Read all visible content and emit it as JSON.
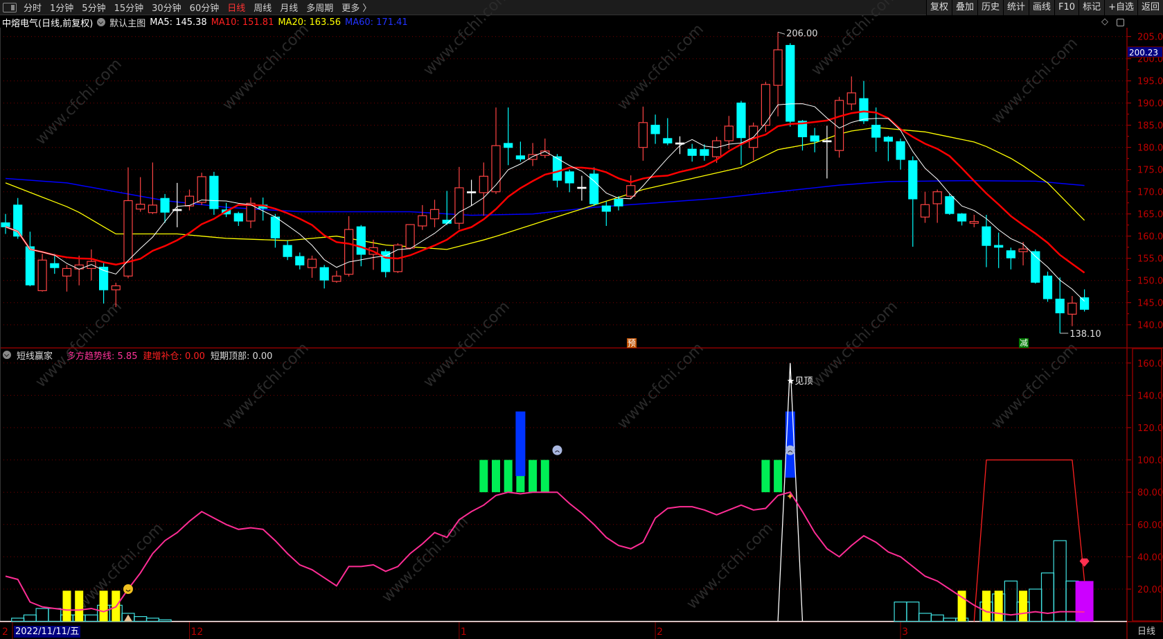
{
  "toolbar": {
    "periods": [
      "分时",
      "1分钟",
      "5分钟",
      "15分钟",
      "30分钟",
      "60分钟",
      "日线",
      "周线",
      "月线",
      "多周期",
      "更多 〉"
    ],
    "active": "日线",
    "right_buttons": [
      "复权",
      "叠加",
      "历史",
      "统计",
      "画线",
      "F10",
      "标记",
      "+自选",
      "返回"
    ]
  },
  "info": {
    "stock": "中熔电气(日线,前复权)",
    "template": "默认主图",
    "ma5": "MA5: 145.38",
    "ma10": "MA10: 151.81",
    "ma20": "MA20: 163.56",
    "ma60": "MA60: 171.41"
  },
  "colors": {
    "up": "#ff4444",
    "down": "#00ffff",
    "ma5": "#ffffff",
    "ma10": "#ff0000",
    "ma20": "#ffff00",
    "ma60": "#0000ff",
    "grid": "#7a0000",
    "axis": "#c00000"
  },
  "indicator": {
    "name": "短线赢家",
    "trend": "多方趋势线: 5.85",
    "add": "建增补仓: 0.00",
    "top": "短期顶部: 0.00",
    "top_label": "★见顶"
  },
  "cursor": {
    "date": "2022/11/11/五",
    "price": "200.23"
  },
  "period_label": "日线",
  "markers": {
    "pre": "预",
    "reduce": "减"
  },
  "watermark": "www.cfchi.com",
  "chart_data": {
    "type": "candlestick",
    "price_axis": {
      "min": 137,
      "max": 207,
      "ticks": [
        "205.0",
        "200.0",
        "195.0",
        "190.0",
        "185.0",
        "180.0",
        "175.0",
        "170.0",
        "165.0",
        "160.0",
        "155.0",
        "150.0",
        "145.0",
        "140.0"
      ]
    },
    "ind_axis": {
      "ticks": [
        "160.0",
        "140.0",
        "120.0",
        "100.0",
        "80.00",
        "60.00",
        "40.00",
        "20.00"
      ]
    },
    "date_ticks": [
      {
        "i": 0,
        "label": "2"
      },
      {
        "i": 15,
        "label": "12"
      },
      {
        "i": 37,
        "label": "1"
      },
      {
        "i": 53,
        "label": "2"
      },
      {
        "i": 73,
        "label": "3"
      }
    ],
    "high_label": {
      "i": 63,
      "text": "206.00",
      "value": 206
    },
    "low_label": {
      "i": 86,
      "text": "138.10",
      "value": 138.1
    },
    "ohlc": [
      [
        163,
        165,
        160.5,
        162.1
      ],
      [
        167,
        168.6,
        159.4,
        160
      ],
      [
        157.6,
        161,
        148.7,
        149
      ],
      [
        147.7,
        156,
        147.5,
        154.6
      ],
      [
        153.8,
        156,
        151.5,
        152.9
      ],
      [
        151,
        153.5,
        147.5,
        152.7
      ],
      [
        152.6,
        155.6,
        148.9,
        153.5
      ],
      [
        152.7,
        157,
        150,
        154.3
      ],
      [
        153,
        154,
        144.8,
        147.9
      ],
      [
        147.9,
        149.5,
        144,
        148.8
      ],
      [
        151,
        175.5,
        150.5,
        168
      ],
      [
        166.1,
        173.3,
        165.5,
        167.2
      ],
      [
        165.3,
        176.6,
        165,
        167
      ],
      [
        168.5,
        169.5,
        163,
        165.4
      ],
      [
        166,
        172,
        162,
        166
      ],
      [
        166.8,
        170.5,
        165.8,
        169
      ],
      [
        167.6,
        174.3,
        167,
        173.4
      ],
      [
        173.5,
        174.5,
        164.8,
        166.2
      ],
      [
        165.9,
        167.5,
        164.3,
        165
      ],
      [
        165.1,
        165.5,
        162.3,
        163.4
      ],
      [
        163.4,
        168.7,
        161.8,
        167.4
      ],
      [
        167,
        168.7,
        163.5,
        166.3
      ],
      [
        164.3,
        165,
        157.4,
        159.6
      ],
      [
        157.9,
        159,
        154.6,
        155.4
      ],
      [
        155.4,
        156.3,
        152.5,
        153.5
      ],
      [
        152.9,
        155.6,
        150.6,
        154.8
      ],
      [
        152.9,
        153.5,
        148.2,
        150.1
      ],
      [
        149.8,
        152.2,
        149.5,
        151
      ],
      [
        151.4,
        164.5,
        150.9,
        161.5
      ],
      [
        162.1,
        162.5,
        153.2,
        155.9
      ],
      [
        155.9,
        159.2,
        152.4,
        157.4
      ],
      [
        156.5,
        157,
        150.7,
        152
      ],
      [
        152,
        158.4,
        151.7,
        158
      ],
      [
        157.3,
        162.7,
        157,
        162.6
      ],
      [
        162.3,
        167,
        161.4,
        164.6
      ],
      [
        163.9,
        168.2,
        162,
        166
      ],
      [
        163.6,
        170.2,
        162.5,
        162.9
      ],
      [
        162.9,
        175.6,
        161.5,
        170.9
      ],
      [
        170,
        172.7,
        166.9,
        170
      ],
      [
        169.8,
        176.6,
        164.6,
        173.5
      ],
      [
        170,
        189,
        169.5,
        180.4
      ],
      [
        180.9,
        189,
        176,
        180
      ],
      [
        178.1,
        181.3,
        176.8,
        177.4
      ],
      [
        177.3,
        181,
        175.8,
        178.4
      ],
      [
        178.2,
        182,
        177.6,
        179.2
      ],
      [
        177.9,
        178.5,
        171,
        172.6
      ],
      [
        174.5,
        175,
        169.9,
        172
      ],
      [
        171,
        173.6,
        168,
        171
      ],
      [
        174,
        175.5,
        166.8,
        167.3
      ],
      [
        166.8,
        167.8,
        162.3,
        165.6
      ],
      [
        168.3,
        169,
        165.8,
        166.8
      ],
      [
        169,
        173.7,
        168.4,
        171.4
      ],
      [
        180,
        189.2,
        177,
        185.6
      ],
      [
        185,
        187.4,
        180.8,
        183.1
      ],
      [
        182,
        186.6,
        180.5,
        181
      ],
      [
        181,
        182.5,
        178.5,
        181
      ],
      [
        179.6,
        180.8,
        176.8,
        178.2
      ],
      [
        179.5,
        180.7,
        177,
        178.2
      ],
      [
        177.9,
        182.4,
        176.5,
        181.5
      ],
      [
        181.5,
        187.1,
        179.6,
        184.8
      ],
      [
        190,
        190.5,
        176.1,
        182.2
      ],
      [
        180,
        185.6,
        177.1,
        184.8
      ],
      [
        185,
        194.8,
        183.5,
        194.2
      ],
      [
        194,
        206,
        187,
        202
      ],
      [
        203,
        203.5,
        184.7,
        185.9
      ],
      [
        185.9,
        186.2,
        179.3,
        182.4
      ],
      [
        182.6,
        184.4,
        178.9,
        181.4
      ],
      [
        181.5,
        184.9,
        173,
        181.5
      ],
      [
        179.3,
        191.4,
        177.7,
        190.6
      ],
      [
        189.8,
        196,
        188.4,
        192.3
      ],
      [
        191,
        195,
        185.3,
        186
      ],
      [
        185,
        189,
        179,
        182.3
      ],
      [
        182.3,
        182.6,
        176.9,
        181.4
      ],
      [
        181.3,
        182,
        175,
        177.3
      ],
      [
        177,
        178,
        157.6,
        168.4
      ],
      [
        164.3,
        170,
        163,
        167.1
      ],
      [
        167.3,
        170.5,
        163,
        170
      ],
      [
        168.9,
        169.5,
        164.8,
        165.1
      ],
      [
        165,
        165.2,
        162.4,
        163.4
      ],
      [
        162.9,
        164.8,
        162,
        163.3
      ],
      [
        162.1,
        164.8,
        153,
        157.9
      ],
      [
        157.9,
        160.8,
        152.8,
        157.5
      ],
      [
        156.7,
        157.4,
        152.5,
        155.1
      ],
      [
        156.5,
        158.7,
        153.4,
        157.1
      ],
      [
        156.5,
        157,
        149.3,
        149.6
      ],
      [
        151,
        152,
        145.2,
        145.9
      ],
      [
        145.8,
        150.7,
        138.1,
        142.7
      ],
      [
        142.4,
        146.5,
        139.7,
        144.9
      ],
      [
        146.1,
        148,
        143,
        143.5
      ]
    ],
    "ma20_anchors": [
      [
        0,
        172
      ],
      [
        5.6,
        166
      ],
      [
        9,
        160.5
      ],
      [
        14,
        160.5
      ],
      [
        18,
        159.5
      ],
      [
        23,
        159
      ],
      [
        27,
        160
      ],
      [
        31,
        158
      ],
      [
        36,
        157
      ],
      [
        39.5,
        159.5
      ],
      [
        44,
        163.5
      ],
      [
        48,
        167
      ],
      [
        52,
        170.5
      ],
      [
        56,
        173
      ],
      [
        60,
        175.5
      ],
      [
        63,
        179.5
      ],
      [
        66,
        181
      ],
      [
        68.5,
        183.5
      ],
      [
        71,
        184.5
      ],
      [
        75,
        183.5
      ],
      [
        79.4,
        181
      ],
      [
        82.4,
        177
      ],
      [
        85,
        172
      ],
      [
        88,
        163.56
      ]
    ],
    "ma60_anchors": [
      [
        0,
        173
      ],
      [
        5,
        172
      ],
      [
        9,
        170
      ],
      [
        13,
        168
      ],
      [
        18,
        166.5
      ],
      [
        24,
        165.5
      ],
      [
        33,
        165.5
      ],
      [
        38,
        164.7
      ],
      [
        43,
        165
      ],
      [
        48,
        166.5
      ],
      [
        53,
        167.5
      ],
      [
        58,
        168.5
      ],
      [
        63,
        170
      ],
      [
        68,
        171.5
      ],
      [
        72,
        172.3
      ],
      [
        78,
        172.5
      ],
      [
        84,
        172.4
      ],
      [
        88,
        171.41
      ]
    ],
    "trend_line": [
      28,
      26,
      12,
      9,
      8,
      7,
      7,
      8,
      6,
      9,
      20,
      30,
      42,
      50,
      55,
      62,
      68,
      64,
      60,
      57,
      58,
      57,
      50,
      42,
      35,
      32,
      27,
      22,
      34,
      34,
      35,
      31,
      34,
      42,
      48,
      55,
      52,
      63,
      68,
      72,
      78,
      80,
      79,
      80,
      80,
      80,
      73,
      67,
      60,
      52,
      47,
      45,
      49,
      64,
      70,
      71,
      71,
      69,
      66,
      69,
      72,
      69,
      70,
      78,
      80,
      68,
      55,
      45,
      40,
      47,
      53,
      49,
      43,
      40,
      34,
      28,
      25,
      20,
      15,
      10,
      6,
      5,
      4,
      5,
      6,
      5,
      6,
      6,
      5.85
    ],
    "green_bars": [
      39,
      40,
      41,
      42,
      43,
      44,
      62,
      63
    ],
    "green_range": [
      80,
      100
    ],
    "blue_bars": [
      {
        "i": 42,
        "from": 90,
        "to": 130
      },
      {
        "i": 64,
        "from": 89,
        "to": 130
      }
    ],
    "yellow_bars": [
      5,
      6,
      8,
      9,
      78,
      80,
      81,
      83
    ],
    "yellow_range": [
      0,
      19
    ],
    "cyan_hist": {
      "1": 2,
      "2": 4,
      "3": 8,
      "4": 8,
      "5": 4,
      "6": 4,
      "7": 4,
      "8": 10,
      "9": 10,
      "10": 5,
      "11": 3,
      "12": 2,
      "13": 1,
      "73": 12,
      "74": 12,
      "75": 5,
      "76": 4,
      "77": 2,
      "78": 2,
      "80": 12,
      "81": 17,
      "82": 25,
      "83": 12,
      "84": 20,
      "85": 30,
      "86": 50,
      "87": 25
    },
    "magenta_bar": {
      "i": 88,
      "value": 25
    },
    "white_spike": {
      "i": 64,
      "value": 160
    },
    "red_line": [
      [
        79,
        0
      ],
      [
        80,
        100
      ],
      [
        87,
        100
      ],
      [
        88,
        25
      ]
    ],
    "icons": [
      {
        "type": "smile",
        "i": 10,
        "v": 20
      },
      {
        "type": "figure",
        "i": 10,
        "v": 0
      },
      {
        "type": "frown",
        "i": 45,
        "v": 106
      },
      {
        "type": "frown",
        "i": 64,
        "v": 106
      },
      {
        "type": "runner",
        "i": 64,
        "v": 78
      },
      {
        "type": "gem",
        "i": 88,
        "v": 36
      }
    ]
  }
}
